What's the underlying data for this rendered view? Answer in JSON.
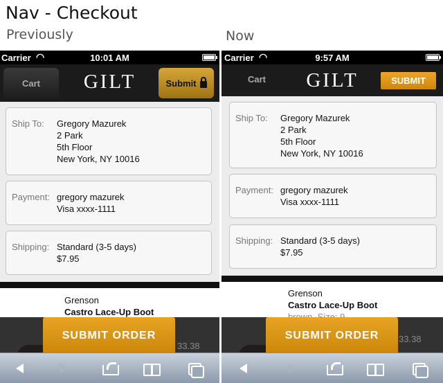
{
  "title": "Nav - Checkout",
  "labels": {
    "previously": "Previously",
    "now": "Now"
  },
  "previously": {
    "status": {
      "carrier": "Carrier",
      "time": "10:01 AM"
    },
    "nav": {
      "cart_label": "Cart",
      "brand": "GILT",
      "submit_label": "Submit"
    },
    "ship": {
      "label": "Ship To:",
      "lines": [
        "Gregory Mazurek",
        "2 Park",
        "5th Floor",
        "New York, NY  10016"
      ]
    },
    "payment": {
      "label": "Payment:",
      "lines": [
        "gregory mazurek",
        "Visa xxxx-1111"
      ]
    },
    "shipping": {
      "label": "Shipping:",
      "lines": [
        "Standard (3-5 days)",
        "$7.95"
      ]
    },
    "product": {
      "brand": "Grenson",
      "name": "Castro Lace-Up Boot",
      "price_partial": "33.38"
    },
    "order_button": "SUBMIT ORDER"
  },
  "now": {
    "status": {
      "carrier": "Carrier",
      "time": "9:57 AM"
    },
    "nav": {
      "cart_label": "Cart",
      "brand": "GILT",
      "submit_label": "SUBMIT"
    },
    "ship": {
      "label": "Ship To:",
      "lines": [
        "Gregory Mazurek",
        "2 Park",
        "5th Floor",
        "New York, NY  10016"
      ]
    },
    "payment": {
      "label": "Payment:",
      "lines": [
        "gregory mazurek",
        "Visa xxxx-1111"
      ]
    },
    "shipping": {
      "label": "Shipping:",
      "lines": [
        "Standard (3-5 days)",
        "$7.95"
      ]
    },
    "product": {
      "brand": "Grenson",
      "name": "Castro Lace-Up Boot",
      "detail": "brown, Size: 9",
      "price_partial": "33.38"
    },
    "order_button": "SUBMIT ORDER"
  },
  "icons": {
    "wifi": "wifi-icon",
    "battery": "battery-icon",
    "lock": "lock-icon",
    "back": "back-arrow-icon",
    "forward": "forward-arrow-icon",
    "share": "share-icon",
    "bookmarks": "bookmarks-icon",
    "tabs": "tabs-icon"
  },
  "colors": {
    "gold_button": "#d99a1b",
    "navbar": "#1b1b1b",
    "toolbar": "#9aa7b7"
  }
}
